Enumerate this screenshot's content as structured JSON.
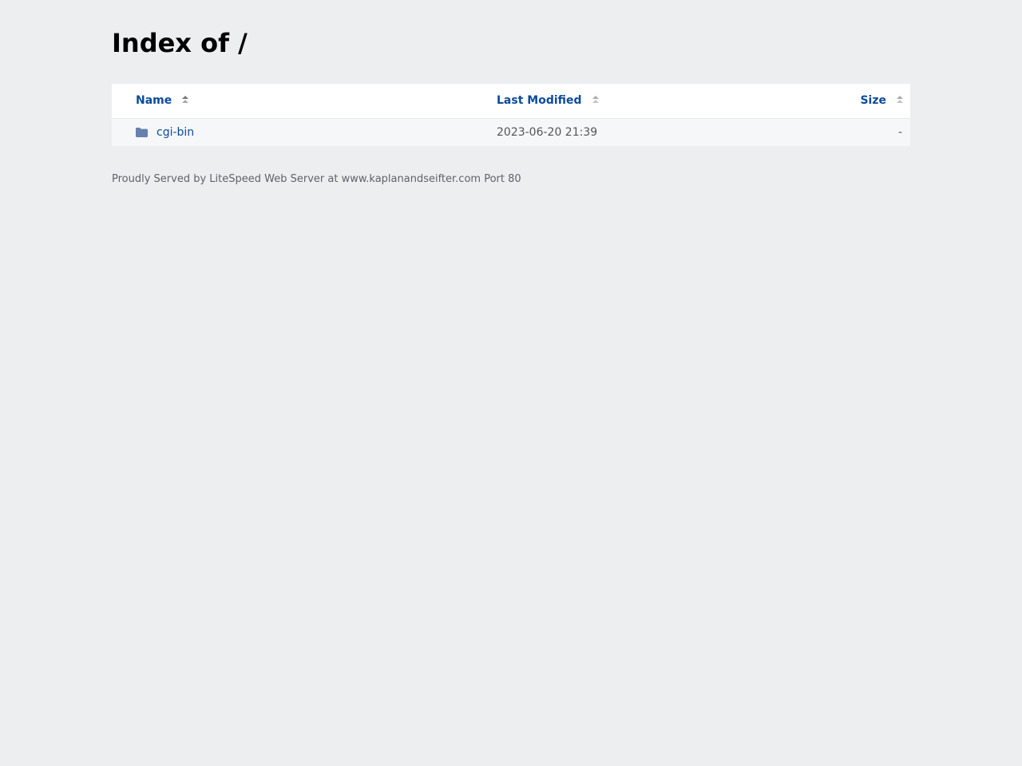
{
  "page": {
    "title": "Index of /"
  },
  "table": {
    "headers": {
      "name": "Name",
      "last_modified": "Last Modified",
      "size": "Size"
    },
    "rows": [
      {
        "icon": "folder-icon",
        "name": "cgi-bin",
        "last_modified": "2023-06-20 21:39",
        "size": "-"
      }
    ]
  },
  "footer": {
    "text": "Proudly Served by LiteSpeed Web Server at www.kaplanandseifter.com Port 80"
  },
  "colors": {
    "background": "#edeef0",
    "link": "#0b4b9a",
    "folder": "#6880ac"
  }
}
